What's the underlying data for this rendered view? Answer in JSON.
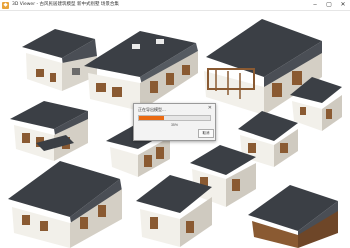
{
  "window": {
    "app_icon": "app-logo-icon",
    "title": "3D Viewer - 古风民居建筑模型 新中式别墅 场景合集",
    "controls": [
      "minimize-icon",
      "maximize-icon",
      "close-icon"
    ],
    "minimize_glyph": "–",
    "maximize_glyph": "▢",
    "close_glyph": "✕"
  },
  "dialog": {
    "title": "正在导出模型...",
    "close_glyph": "✕",
    "progress": 0.35,
    "percent_text": "35%",
    "cancel_label": "取消"
  },
  "colors": {
    "accent": "#ea6a12",
    "roof": "#3b3f45",
    "wall": "#f2f0ea",
    "wood": "#8a5a32"
  }
}
